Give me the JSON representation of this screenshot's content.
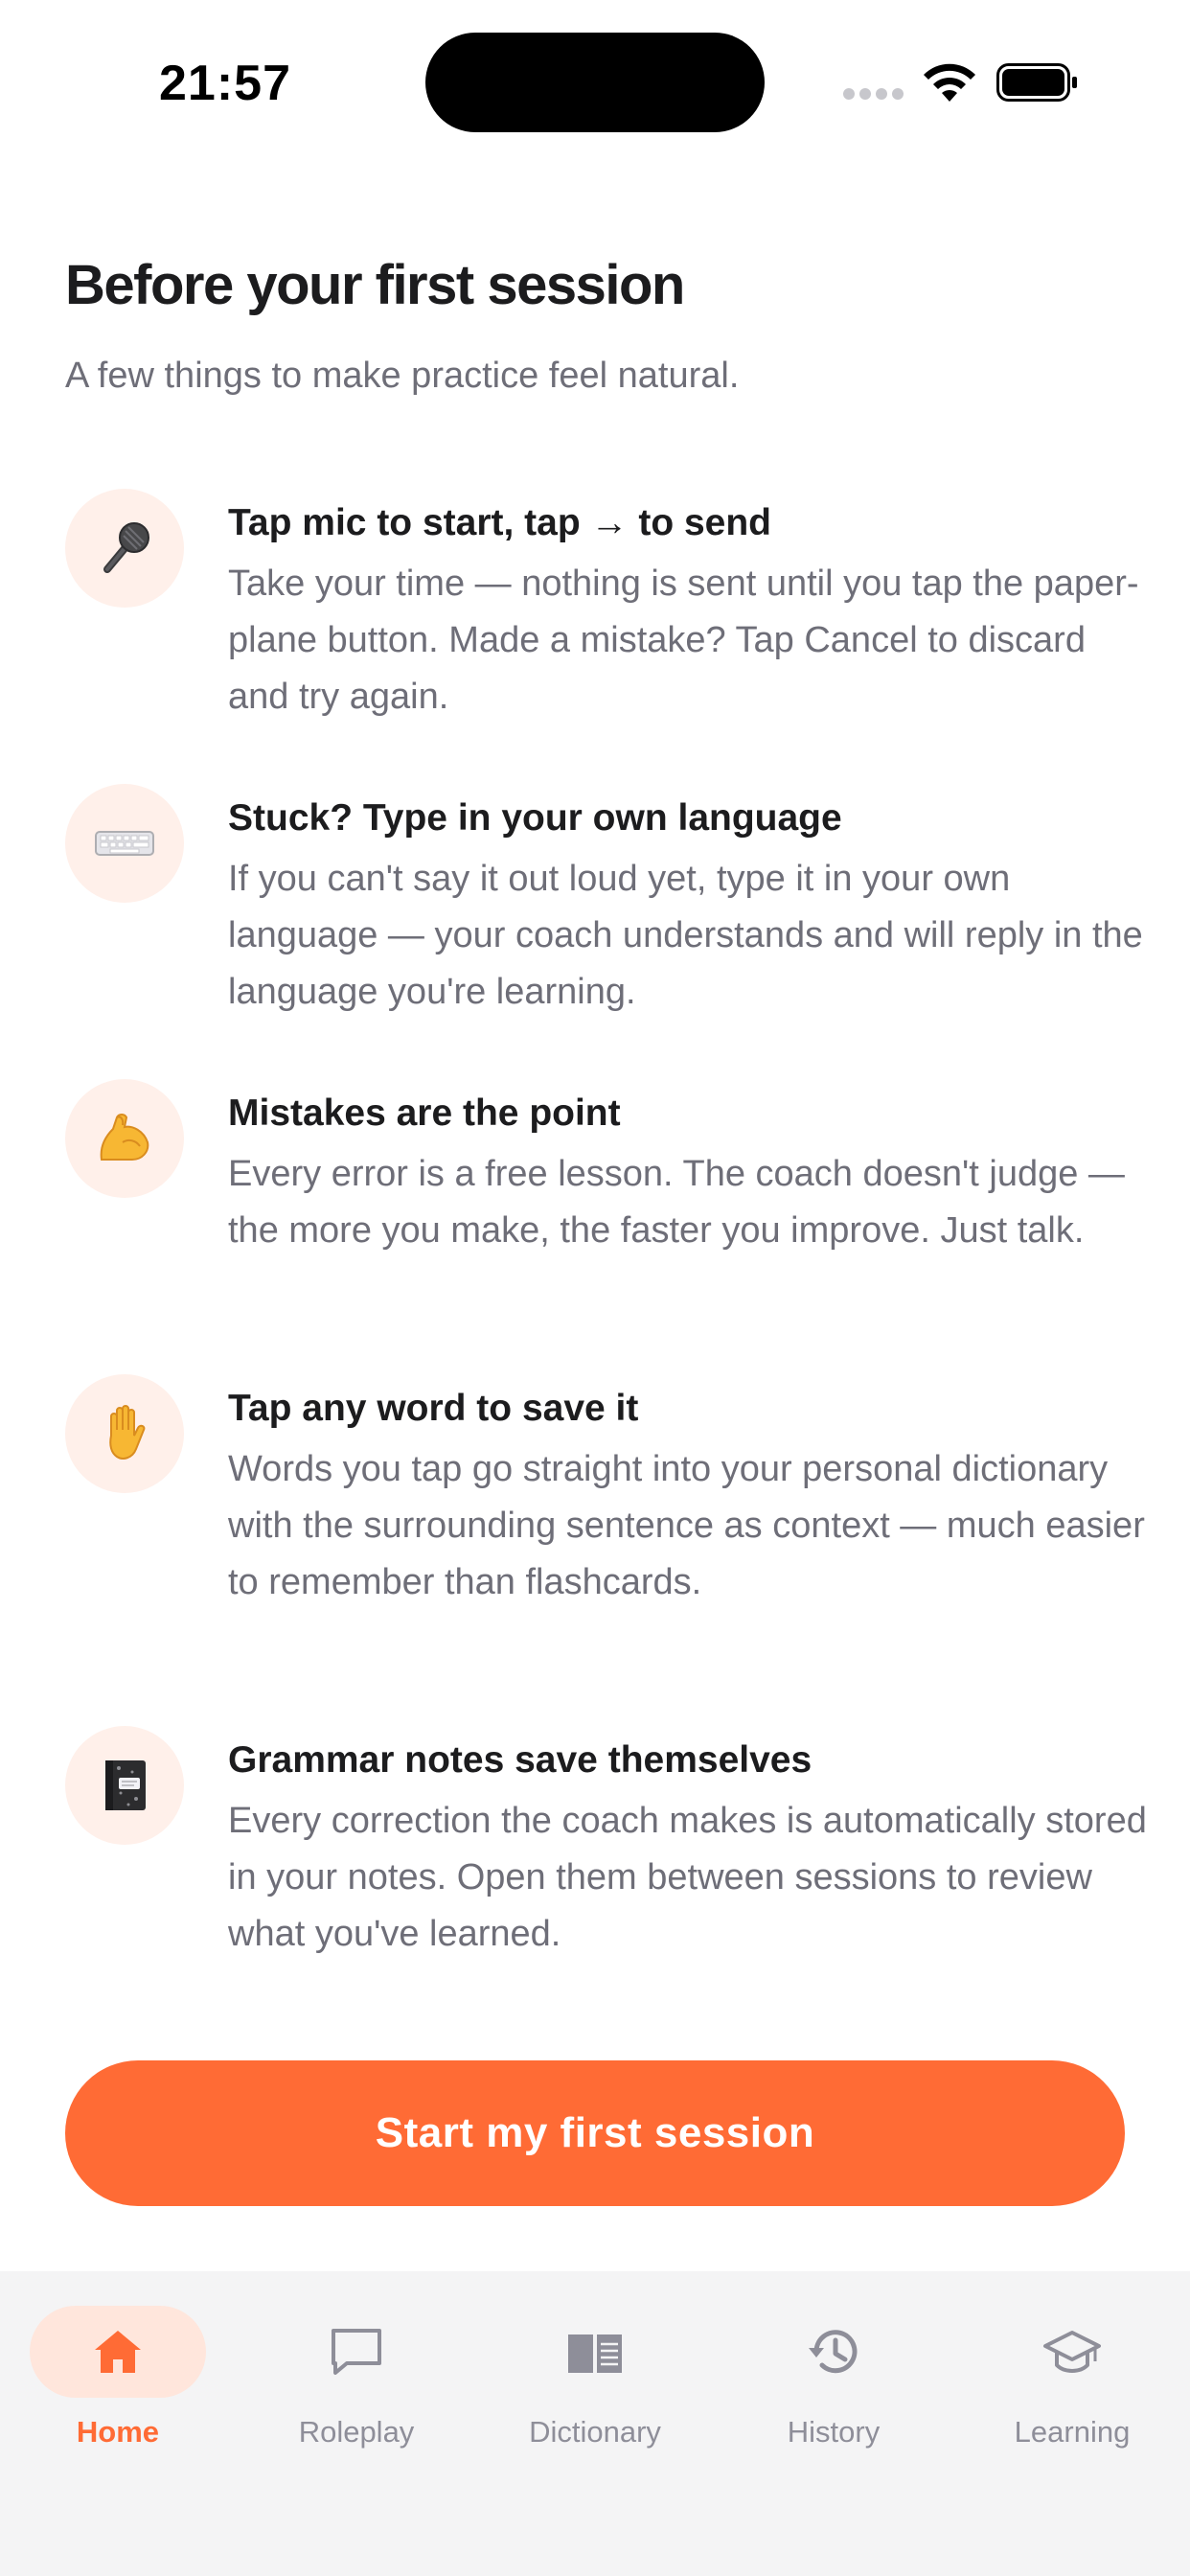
{
  "status_bar": {
    "time": "21:57"
  },
  "header": {
    "title": "Before your first session",
    "subtitle": "A few things to make practice feel natural."
  },
  "tips": [
    {
      "icon": "microphone-icon",
      "title": "Tap mic to start, tap → to send",
      "body": "Take your time — nothing is sent until you tap the paper-plane button. Made a mistake? Tap Cancel to discard and try again."
    },
    {
      "icon": "keyboard-icon",
      "title": "Stuck? Type in your own language",
      "body": "If you can't say it out loud yet, type it in your own language — your coach understands and will reply in the language you're learning."
    },
    {
      "icon": "flexed-biceps-icon",
      "title": "Mistakes are the point",
      "body": "Every error is a free lesson. The coach doesn't judge — the more you make, the faster you improve. Just talk."
    },
    {
      "icon": "raised-hand-icon",
      "title": "Tap any word to save it",
      "body": "Words you tap go straight into your personal dictionary with the surrounding sentence as context — much easier to remember than flashcards."
    },
    {
      "icon": "notebook-icon",
      "title": "Grammar notes save themselves",
      "body": "Every correction the coach makes is automatically stored in your notes. Open them between sessions to review what you've learned."
    }
  ],
  "cta": {
    "label": "Start my first session"
  },
  "tab_bar": {
    "tabs": [
      {
        "label": "Home",
        "icon": "home-icon",
        "active": true
      },
      {
        "label": "Roleplay",
        "icon": "chat-bubble-icon",
        "active": false
      },
      {
        "label": "Dictionary",
        "icon": "book-icon",
        "active": false
      },
      {
        "label": "History",
        "icon": "history-icon",
        "active": false
      },
      {
        "label": "Learning",
        "icon": "graduation-cap-icon",
        "active": false
      }
    ]
  },
  "colors": {
    "accent": "#ff6b35",
    "icon_bg": "#fff0ea",
    "text_primary": "#1c1c1e",
    "text_secondary": "#6e6e78",
    "tab_inactive": "#8e8e99",
    "tab_bar_bg": "#f4f4f5"
  }
}
